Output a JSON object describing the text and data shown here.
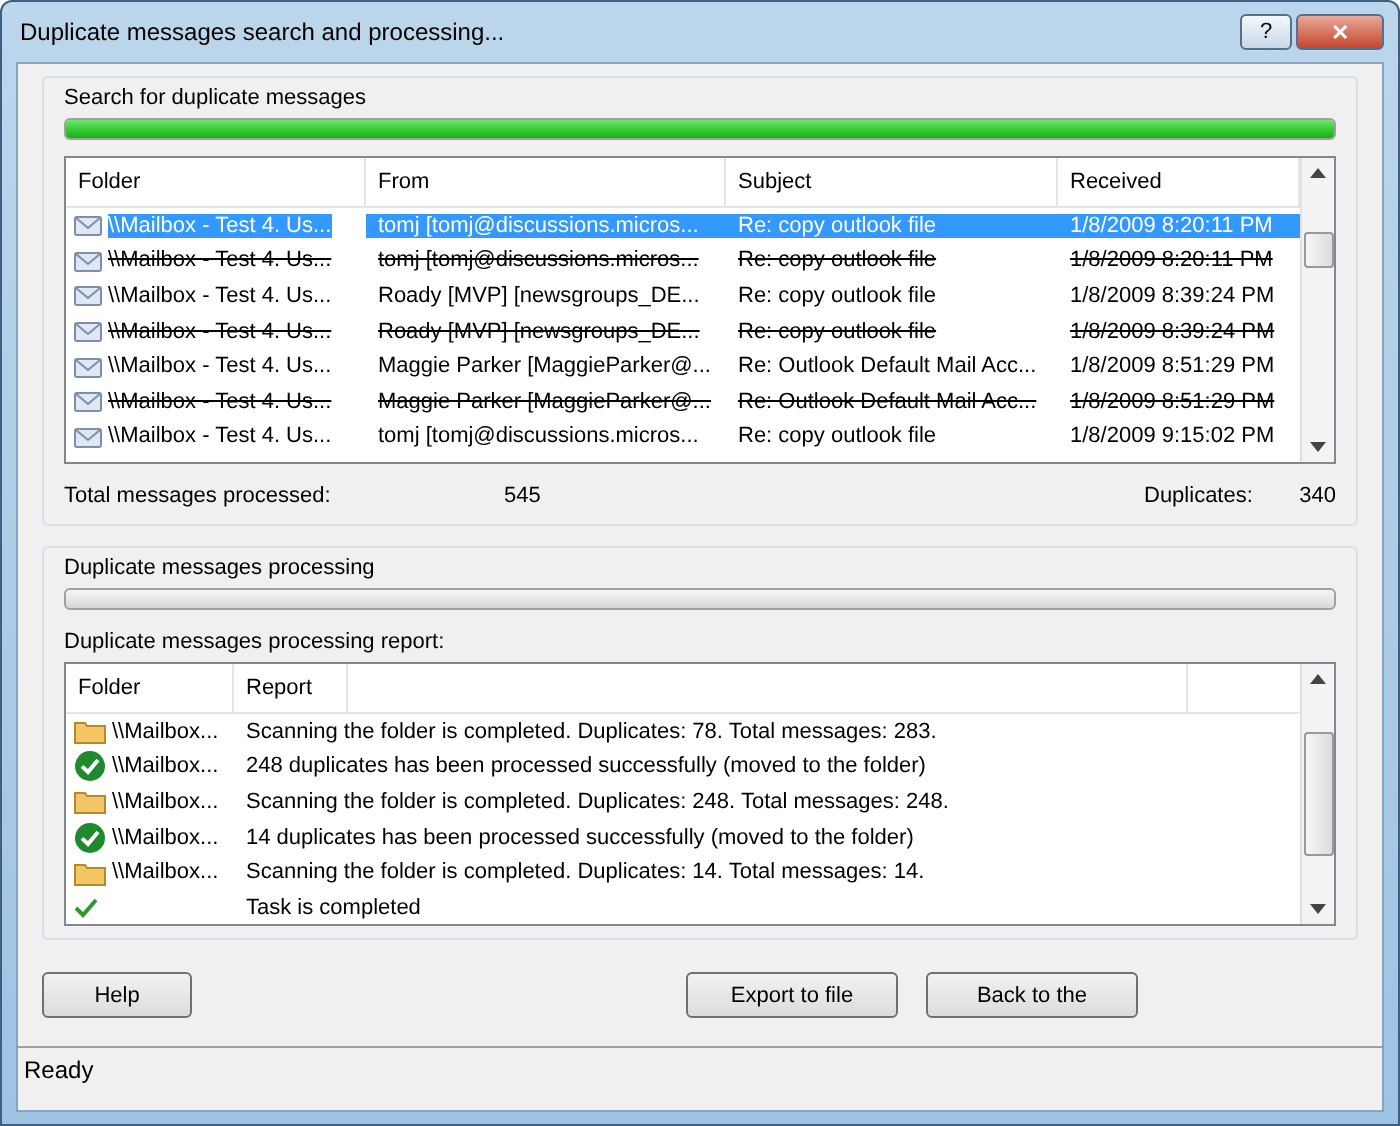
{
  "window": {
    "title": "Duplicate messages search and processing...",
    "help_button": "?",
    "close_button": "✕"
  },
  "search": {
    "title": "Search for duplicate messages",
    "progress": {
      "level": 1
    },
    "columns": [
      "Folder",
      "From",
      "Subject",
      "Received"
    ],
    "rows": [
      {
        "folder": "\\\\Mailbox - Test 4. Us...",
        "from": "tomj [tomj@discussions.micros...",
        "subject": "Re: copy outlook file",
        "received": "1/8/2009 8:20:11 PM",
        "selected": true,
        "duplicate": false
      },
      {
        "folder": "\\\\Mailbox - Test 4. Us...",
        "from": "tomj [tomj@discussions.micros...",
        "subject": "Re: copy outlook file",
        "received": "1/8/2009 8:20:11 PM",
        "selected": false,
        "duplicate": true
      },
      {
        "folder": "\\\\Mailbox - Test 4. Us...",
        "from": "Roady [MVP] [newsgroups_DE...",
        "subject": "Re: copy outlook file",
        "received": "1/8/2009 8:39:24 PM",
        "selected": false,
        "duplicate": false
      },
      {
        "folder": "\\\\Mailbox - Test 4. Us...",
        "from": "Roady [MVP] [newsgroups_DE...",
        "subject": "Re: copy outlook file",
        "received": "1/8/2009 8:39:24 PM",
        "selected": false,
        "duplicate": true
      },
      {
        "folder": "\\\\Mailbox - Test 4. Us...",
        "from": "Maggie Parker [MaggieParker@...",
        "subject": "Re: Outlook Default Mail Acc...",
        "received": "1/8/2009 8:51:29 PM",
        "selected": false,
        "duplicate": false
      },
      {
        "folder": "\\\\Mailbox - Test 4. Us...",
        "from": "Maggie Parker [MaggieParker@...",
        "subject": "Re: Outlook Default Mail Acc...",
        "received": "1/8/2009 8:51:29 PM",
        "selected": false,
        "duplicate": true
      },
      {
        "folder": "\\\\Mailbox - Test 4. Us...",
        "from": "tomj [tomj@discussions.micros...",
        "subject": "Re: copy outlook file",
        "received": "1/8/2009 9:15:02 PM",
        "selected": false,
        "duplicate": false
      }
    ],
    "total_label": "Total messages processed:",
    "total_value": "545",
    "duplicates_label": "Duplicates:",
    "duplicates_value": "340"
  },
  "processing": {
    "title": "Duplicate messages processing",
    "progress": {
      "level": 0
    },
    "report_label": "Duplicate messages processing report:",
    "columns": [
      "Folder",
      "Report"
    ],
    "rows": [
      {
        "kind": "folder",
        "folder": "\\\\Mailbox...",
        "report": "Scanning the folder is completed. Duplicates: 78. Total messages: 283."
      },
      {
        "kind": "success",
        "folder": "\\\\Mailbox...",
        "report": "248 duplicates has been processed successfully (moved to the folder)"
      },
      {
        "kind": "folder",
        "folder": "\\\\Mailbox...",
        "report": "Scanning the folder is completed. Duplicates: 248. Total messages: 248."
      },
      {
        "kind": "success",
        "folder": "\\\\Mailbox...",
        "report": "14 duplicates has been processed successfully (moved to the folder)"
      },
      {
        "kind": "folder",
        "folder": "\\\\Mailbox...",
        "report": "Scanning the folder is completed. Duplicates: 14. Total messages: 14."
      },
      {
        "kind": "done",
        "report": "Task is completed"
      }
    ]
  },
  "buttons": [
    {
      "label": "Help"
    },
    {
      "label": "Export to file"
    },
    {
      "label": "Back to the"
    }
  ],
  "status_bar": "Ready"
}
